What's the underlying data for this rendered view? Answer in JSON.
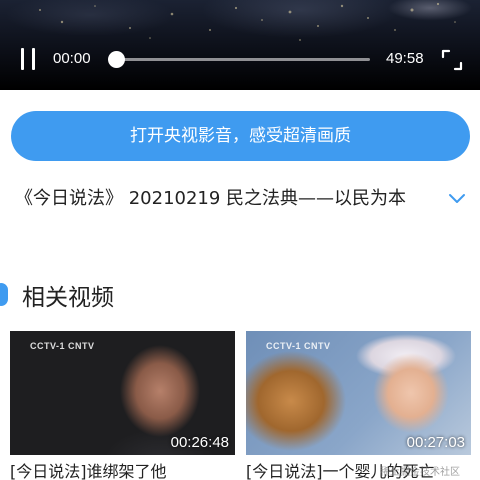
{
  "player": {
    "current_time": "00:00",
    "total_time": "49:58",
    "progress": 0
  },
  "banner": {
    "open_app_label": "打开央视影音，感受超清画质"
  },
  "video": {
    "title": "《今日说法》 20210219 民之法典——以民为本"
  },
  "related": {
    "section_title": "相关视频",
    "items": [
      {
        "title": "[今日说法]谁绑架了他",
        "duration": "00:26:48",
        "logo": "CCTV-1  CNTV"
      },
      {
        "title": "[今日说法]一个婴儿的死亡",
        "duration": "00:27:03",
        "logo": "CCTV-1  CNTV"
      }
    ]
  },
  "watermark": "稀土掘金技术社区",
  "colors": {
    "accent": "#3f9bf0",
    "text": "#222222"
  },
  "icons": {
    "pause": "pause-icon",
    "fullscreen": "fullscreen-icon",
    "expand": "chevron-down-icon"
  }
}
